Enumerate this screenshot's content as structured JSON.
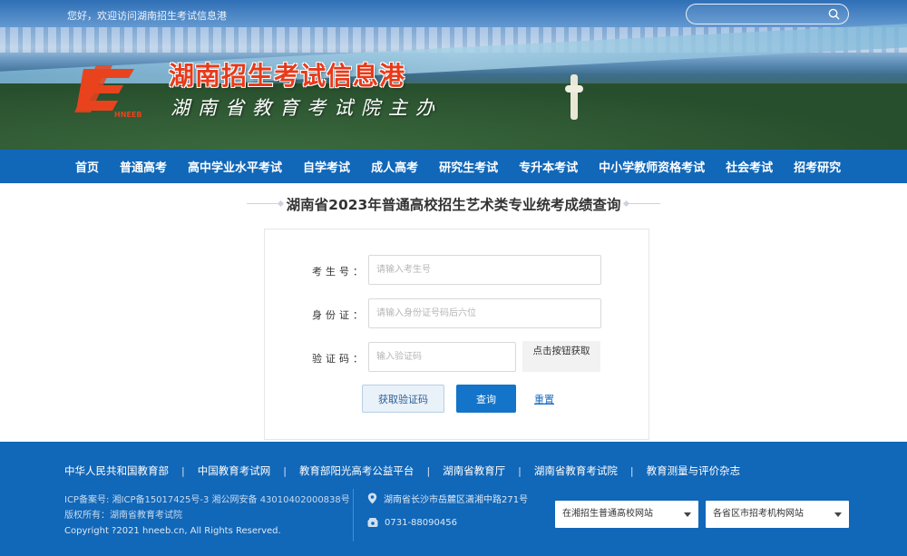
{
  "header": {
    "greeting": "您好，欢迎访问湖南招生考试信息港",
    "search": {
      "placeholder": ""
    },
    "site_title": "湖南招生考试信息港",
    "site_subtitle": "湖南省教育考试院主办",
    "logo": {
      "icon": "hneeb-logo",
      "text": "HNEEB"
    }
  },
  "nav": {
    "items": [
      {
        "label": "首页"
      },
      {
        "label": "普通高考"
      },
      {
        "label": "高中学业水平考试"
      },
      {
        "label": "自学考试"
      },
      {
        "label": "成人高考"
      },
      {
        "label": "研究生考试"
      },
      {
        "label": "专升本考试"
      },
      {
        "label": "中小学教师资格考试"
      },
      {
        "label": "社会考试"
      },
      {
        "label": "招考研究"
      }
    ]
  },
  "main": {
    "page_title": "湖南省2023年普通高校招生艺术类专业统考成绩查询",
    "form": {
      "exam_no": {
        "label": "考生号：",
        "placeholder": "请输入考生号",
        "value": ""
      },
      "id_no": {
        "label": "身份证：",
        "placeholder": "请输入身份证号码后六位",
        "value": ""
      },
      "captcha": {
        "label": "验证码：",
        "placeholder": "输入验证码",
        "value": ""
      },
      "captcha_hint": "点击按钮获取",
      "get_code_label": "获取验证码",
      "query_label": "查询",
      "reset_label": "重置"
    }
  },
  "footer": {
    "links": [
      {
        "label": "中华人民共和国教育部"
      },
      {
        "label": "中国教育考试网"
      },
      {
        "label": "教育部阳光高考公益平台"
      },
      {
        "label": "湖南省教育厅"
      },
      {
        "label": "湖南省教育考试院"
      },
      {
        "label": "教育测量与评价杂志"
      }
    ],
    "icp": "ICP备案号: 湘ICP备15017425号-3 湘公网安备 43010402000838号",
    "owner": "版权所有：湖南省教育考试院",
    "copyright": "Copyright ?2021 hneeb.cn, All Rights Reserved.",
    "address": "湖南省长沙市岳麓区潇湘中路271号",
    "phone": "0731-88090456",
    "select_schools": "在湘招生普通高校网站",
    "select_agencies": "各省区市招考机构网站"
  },
  "colors": {
    "primary_blue": "#1167b8",
    "title_red": "#e83a1a",
    "query_button": "#1474c9"
  }
}
